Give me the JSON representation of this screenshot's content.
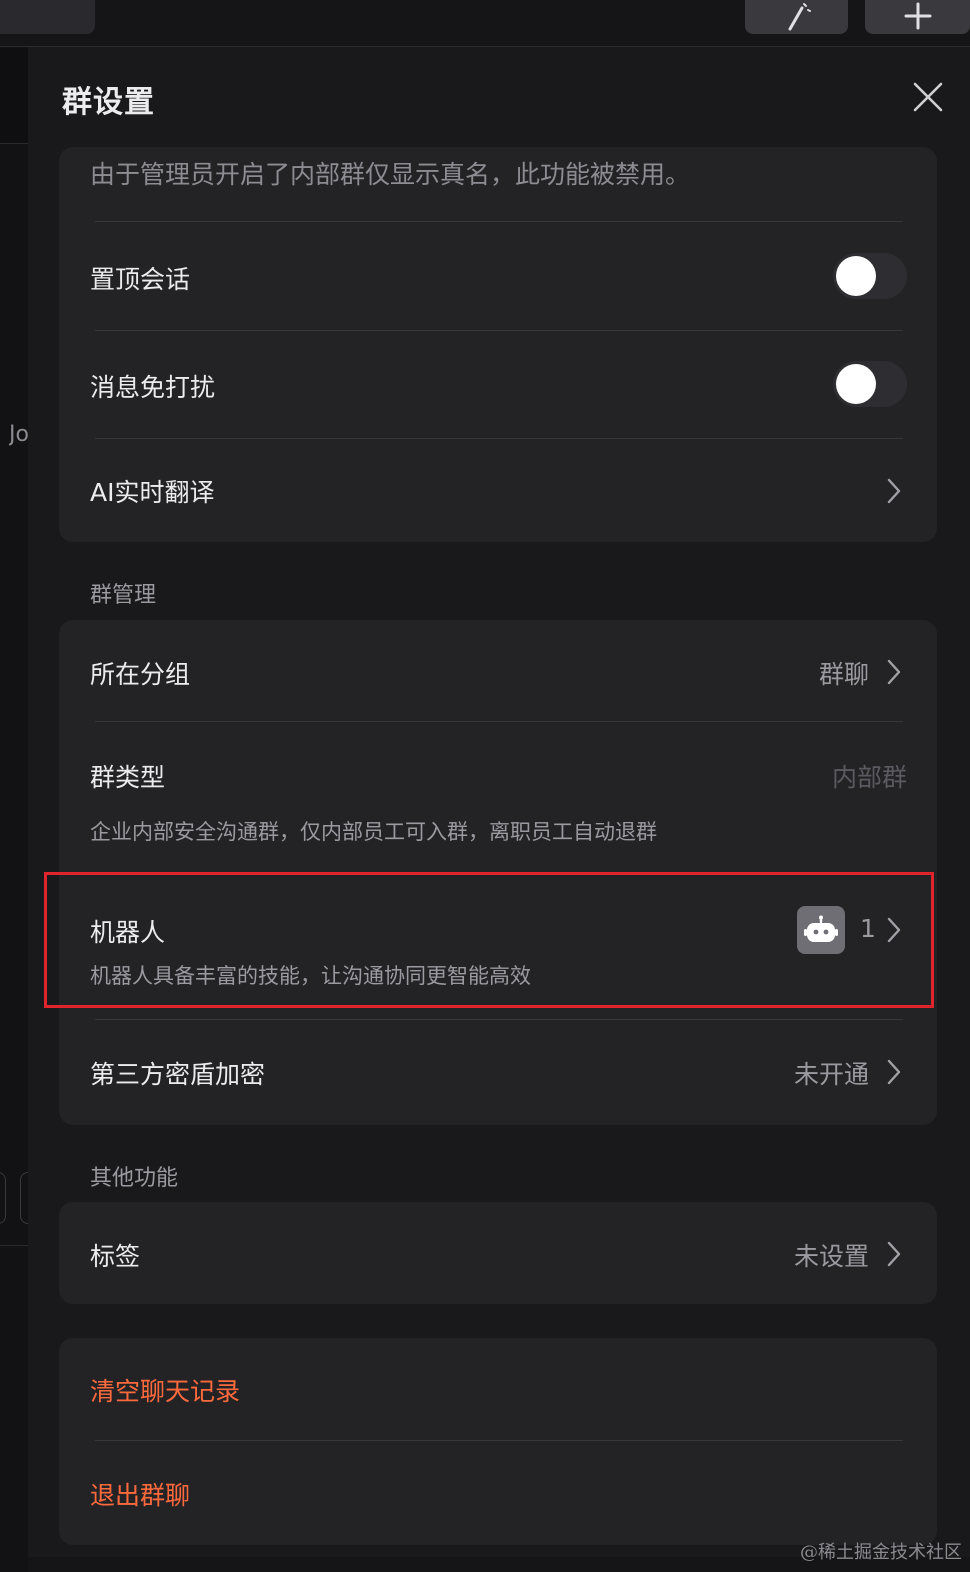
{
  "panel": {
    "title": "群设置"
  },
  "notice": "由于管理员开启了内部群仅显示真名，此功能被禁用。",
  "basic": {
    "items": [
      {
        "label": "置顶会话",
        "toggle": false
      },
      {
        "label": "消息免打扰",
        "toggle": false
      },
      {
        "label": "AI实时翻译"
      }
    ]
  },
  "group_manage": {
    "title": "群管理",
    "group": {
      "label": "所在分组",
      "value": "群聊"
    },
    "type": {
      "label": "群类型",
      "value": "内部群",
      "desc": "企业内部安全沟通群，仅内部员工可入群，离职员工自动退群"
    },
    "robot": {
      "label": "机器人",
      "desc": "机器人具备丰富的技能，让沟通协同更智能高效",
      "count": "1",
      "icon": "robot-icon"
    },
    "encrypt": {
      "label": "第三方密盾加密",
      "value": "未开通"
    }
  },
  "other": {
    "title": "其他功能",
    "tag": {
      "label": "标签",
      "value": "未设置"
    }
  },
  "actions": {
    "clear": "清空聊天记录",
    "exit": "退出群聊"
  },
  "background": {
    "left_text": "Jo"
  },
  "watermark": "@稀土掘金技术社区",
  "colors": {
    "danger": "#ff6a3d",
    "highlight": "#e0242b"
  }
}
